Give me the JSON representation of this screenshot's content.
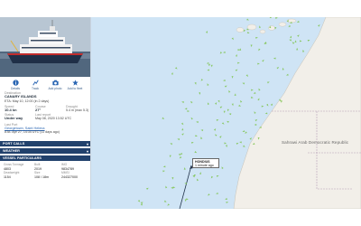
{
  "vessel": {
    "destination_label": "Destination",
    "destination": "CANARY ISLANDS",
    "eta": "ETA: May 10, 12:00 (in 2 days)",
    "speed_label": "Speed",
    "speed": "10.4 kn",
    "course_label": "Course",
    "course": "27°",
    "draught_label": "Draught",
    "draught": "5.4 m (max 5.3)",
    "status_label": "Status",
    "status": "Under way",
    "last_report_label": "Last report",
    "last_report": "May 08, 2020 13:52 UTC",
    "last_port_label": "Last Port",
    "last_port": "Georgetown, Saint Helena",
    "last_port_ata": "ATA: Apr 27, 14:34 UTC (11 days ago)"
  },
  "actions": [
    {
      "label": "Details",
      "icon": "info-icon"
    },
    {
      "label": "Track",
      "icon": "track-icon"
    },
    {
      "label": "Add photo",
      "icon": "camera-icon"
    },
    {
      "label": "Add to fleet",
      "icon": "star-icon"
    }
  ],
  "sections": {
    "port_calls": "PORT CALLS",
    "weather": "WEATHER",
    "particulars": "VESSEL PARTICULARS"
  },
  "particulars": {
    "headers": [
      "Gross Tonnage",
      "Built",
      "IMO",
      "Deadweight",
      "Size",
      "MMSI"
    ],
    "values": [
      "4803",
      "2019",
      "9834789",
      "1154",
      "108 / 18m",
      "244327000"
    ]
  },
  "map": {
    "tooltip_name": "HONDIUS",
    "tooltip_time": "1 minute ago",
    "region_label": "Sahrawi Arab Democratic Republic",
    "sea_color": "#cfe4f5",
    "land_color": "#f2efe9",
    "ship_color": "#7cc34a"
  }
}
